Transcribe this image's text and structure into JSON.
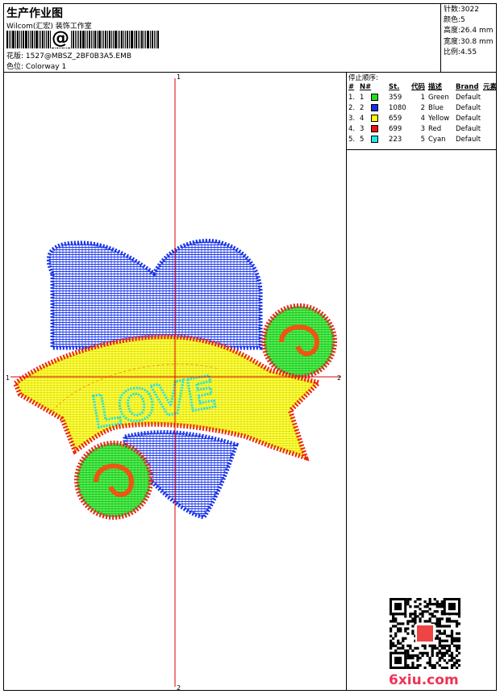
{
  "header": {
    "title": "生产作业图",
    "company": "Wilcom(汇宏) 装饰工作室",
    "barcode_symbol": "@",
    "pattern_label": "花版:",
    "pattern_value": "1527@MBSZ_2BF0B3A5.EMB",
    "colorway_label": "色位:",
    "colorway_value": "Colorway 1"
  },
  "stats": [
    {
      "label": "针数:",
      "value": "3022"
    },
    {
      "label": "颜色:",
      "value": "5"
    },
    {
      "label": "高度:",
      "value": "26.4 mm"
    },
    {
      "label": "宽度:",
      "value": "30.8 mm"
    },
    {
      "label": "比例:",
      "value": "4.55"
    }
  ],
  "stop_sequence": {
    "caption": "停止顺序:",
    "headers": [
      "#",
      "N#",
      "St.",
      "代码",
      "描述",
      "Brand",
      "元素"
    ],
    "rows": [
      {
        "idx": "1.",
        "n": "1",
        "st": "359",
        "code": "1",
        "desc": "Green",
        "brand": "Default",
        "color": "#22dd22"
      },
      {
        "idx": "2.",
        "n": "2",
        "st": "1080",
        "code": "2",
        "desc": "Blue",
        "brand": "Default",
        "color": "#1530e8"
      },
      {
        "idx": "3.",
        "n": "4",
        "st": "659",
        "code": "4",
        "desc": "Yellow",
        "brand": "Default",
        "color": "#ffff00"
      },
      {
        "idx": "4.",
        "n": "3",
        "st": "699",
        "code": "3",
        "desc": "Red",
        "brand": "Default",
        "color": "#ee1111"
      },
      {
        "idx": "5.",
        "n": "5",
        "st": "223",
        "code": "5",
        "desc": "Cyan",
        "brand": "Default",
        "color": "#22e8e8"
      }
    ]
  },
  "axes": {
    "top": "1",
    "bottom": "2",
    "left": "1",
    "right": "2",
    "color": "#dd0000"
  },
  "design_text": "LOVE",
  "watermark": "6xiu.com"
}
